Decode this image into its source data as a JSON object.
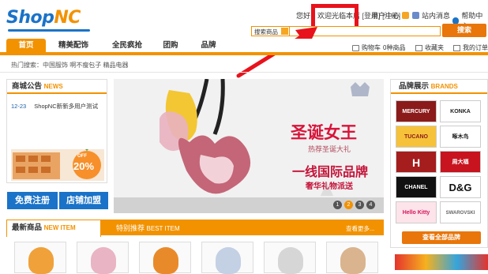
{
  "logo": {
    "shop": "Shop",
    "nc": "NC"
  },
  "header": {
    "greeting": "您好，欢迎光临本店",
    "login": "[登录]",
    "register": "[注册]",
    "user_center": "用户中心",
    "messages": "站内消息",
    "help_center": "帮助中心"
  },
  "search": {
    "category": "搜索商品",
    "button": "搜索"
  },
  "nav": {
    "items": [
      "首页",
      "精美配饰",
      "全民疯抢",
      "团购",
      "品牌"
    ]
  },
  "cart": {
    "label": "购物车",
    "count": "0种商品",
    "favorites": "收藏夹",
    "orders": "我的订单"
  },
  "hot_search": "热门搜索：中国服饰 啊不瘦包子 精品电器",
  "notice": {
    "title": "商城公告",
    "title_en": "NEWS",
    "date": "12-23",
    "text": "ShopNC新新多用户测试",
    "promo_off": "OFF",
    "promo_pct": "20%"
  },
  "buttons": {
    "register": "免费注册",
    "shop_join": "店铺加盟"
  },
  "banner": {
    "headline": "圣诞女王",
    "sub1": "热荐圣诞大礼",
    "headline2": "一线国际品牌",
    "sub2": "奢华礼物派送",
    "pages": [
      "1",
      "2",
      "3",
      "4"
    ],
    "active_page": "2"
  },
  "brands": {
    "title": "品牌展示",
    "title_en": "BRANDS",
    "items": [
      "MERCURY",
      "KONKA",
      "TUCANO",
      "啄木鸟",
      "H",
      "周大福",
      "CHANEL",
      "D&G",
      "Hello Kitty",
      "SWAROVSKI"
    ],
    "button": "查看全部品牌"
  },
  "products": {
    "tab_new": "最新商品",
    "tab_new_en": "NEW ITEM",
    "tab_rec": "特别推荐",
    "tab_rec_en": "BEST ITEM",
    "more": "查看更多..."
  },
  "colors": {
    "accent": "#f29200",
    "blue": "#1a73c8",
    "highlight": "#e8121c"
  }
}
